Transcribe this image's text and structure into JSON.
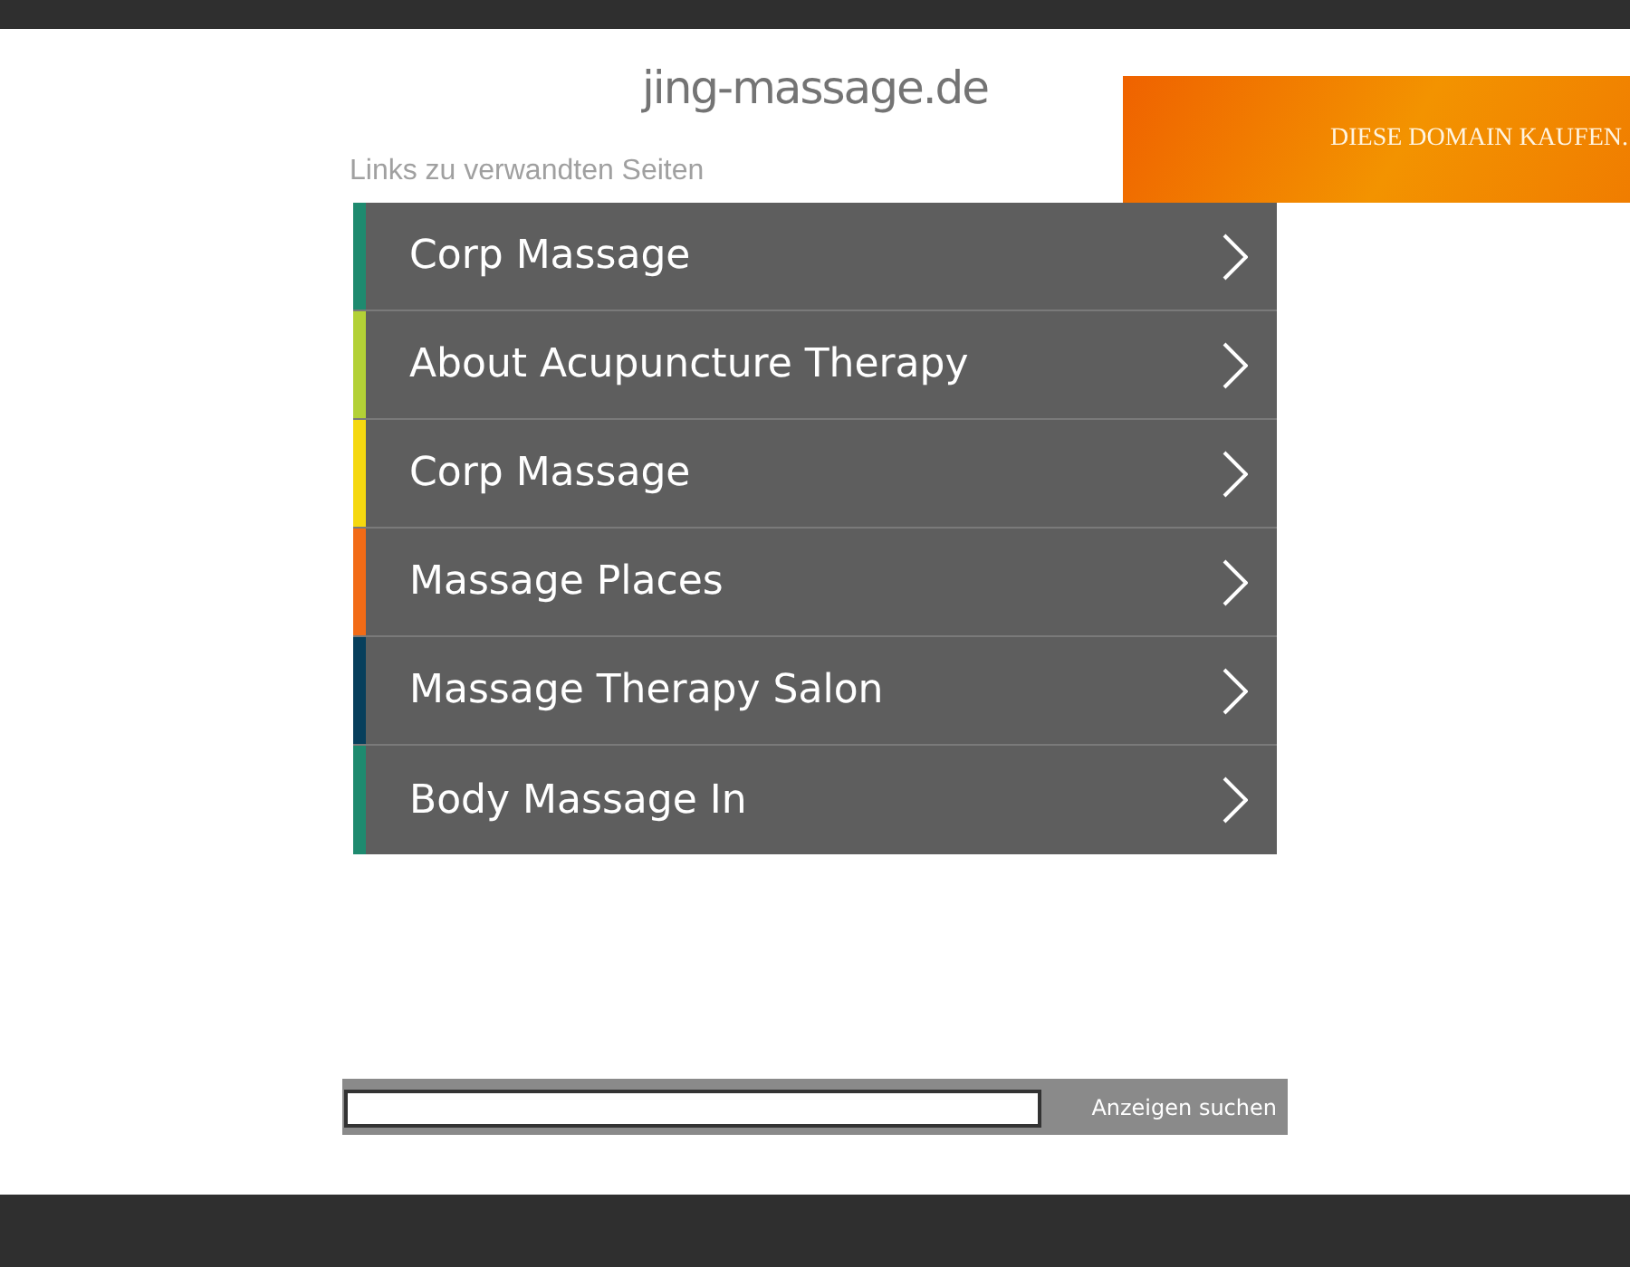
{
  "domain_title": "jing-massage.de",
  "banner": {
    "label": "DIESE DOMAIN KAUFEN."
  },
  "related_heading": "Links zu verwandten Seiten",
  "links": [
    {
      "label": "Corp Massage",
      "color": "#1e8a6f"
    },
    {
      "label": "About Acupuncture Therapy",
      "color": "#b3d136"
    },
    {
      "label": "Corp Massage",
      "color": "#f5d80f"
    },
    {
      "label": "Massage Places",
      "color": "#f26b16"
    },
    {
      "label": "Massage Therapy Salon",
      "color": "#073f5c"
    },
    {
      "label": "Body Massage In",
      "color": "#1e8a6f"
    }
  ],
  "search": {
    "button": "Anzeigen suchen"
  }
}
